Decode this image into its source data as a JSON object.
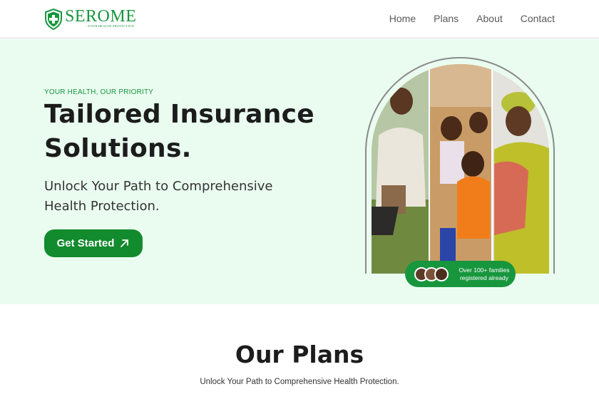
{
  "brand": {
    "name": "SEROME",
    "tagline": "...YOUR HEALTH PROTECTION",
    "color": "#17963e"
  },
  "nav": {
    "items": [
      {
        "label": "Home"
      },
      {
        "label": "Plans"
      },
      {
        "label": "About"
      },
      {
        "label": "Contact"
      }
    ]
  },
  "hero": {
    "eyebrow": "YOUR HEALTH, OUR PRIORITY",
    "title": "Tailored Insurance Solutions.",
    "subtitle": "Unlock Your Path to Comprehensive Health Protection.",
    "cta_label": "Get Started",
    "cta_icon": "arrow-up-right-icon",
    "background_color": "#eafcf0",
    "badge": {
      "text": "Over 100+ families registered already"
    }
  },
  "plans": {
    "title": "Our Plans",
    "subtitle": "Unlock Your Path to Comprehensive Health Protection."
  }
}
